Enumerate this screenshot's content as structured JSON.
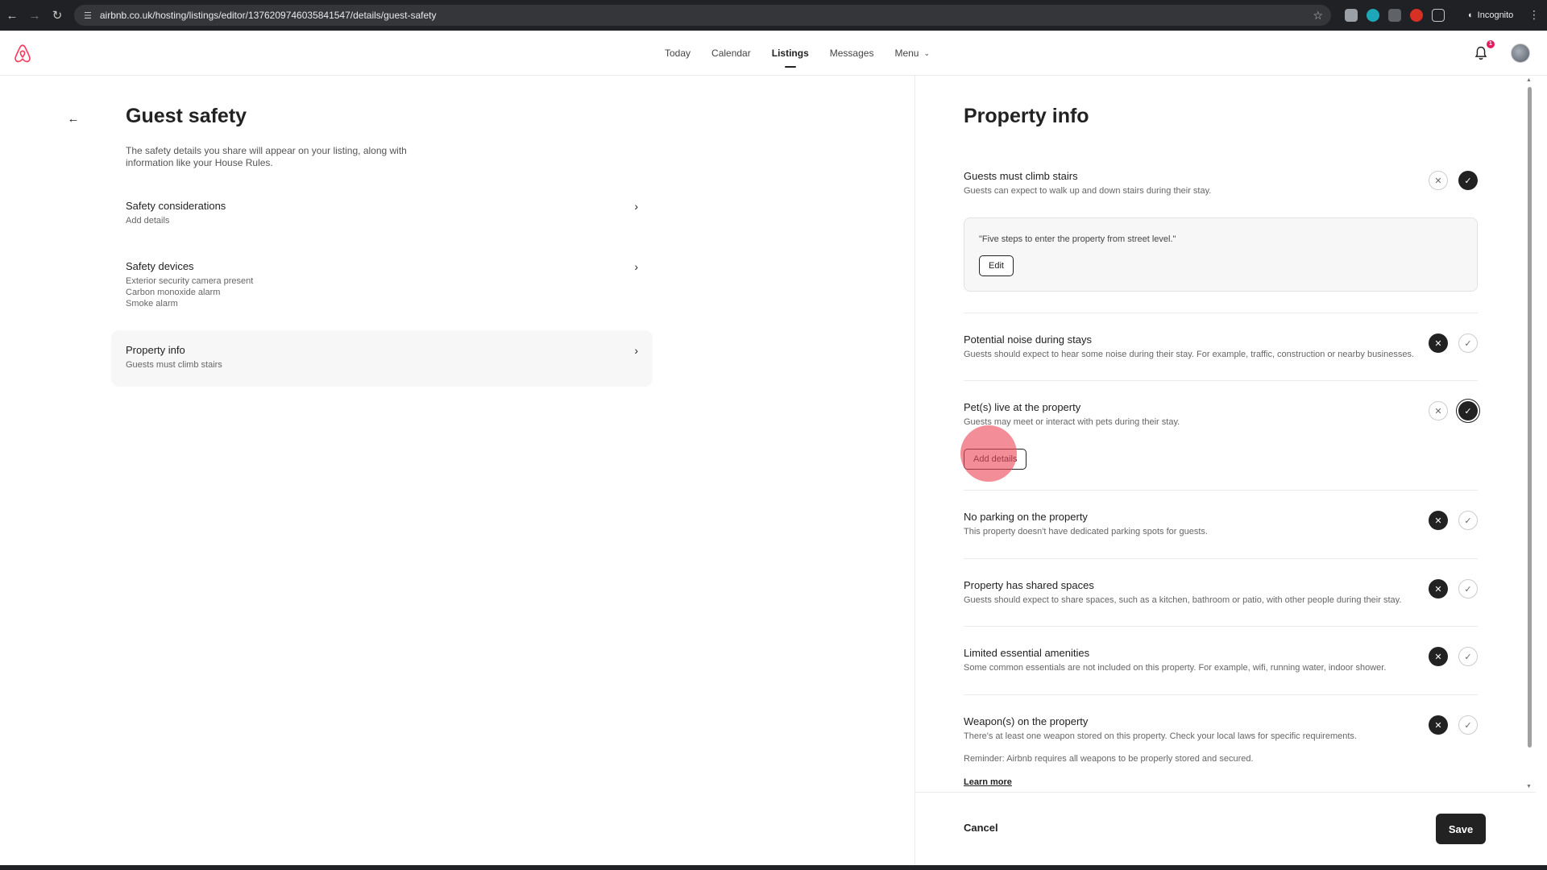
{
  "browser": {
    "url": "airbnb.co.uk/hosting/listings/editor/1376209746035841547/details/guest-safety",
    "incognito_label": "Incognito"
  },
  "topnav": {
    "items": [
      {
        "label": "Today"
      },
      {
        "label": "Calendar"
      },
      {
        "label": "Listings"
      },
      {
        "label": "Messages"
      },
      {
        "label": "Menu"
      }
    ],
    "active": "Listings",
    "notification_count": "1"
  },
  "left": {
    "title": "Guest safety",
    "description": "The safety details you share will appear on your listing, along with information like your House Rules.",
    "sections": [
      {
        "title": "Safety considerations",
        "subs": [
          "Add details"
        ]
      },
      {
        "title": "Safety devices",
        "subs": [
          "Exterior security camera present",
          "Carbon monoxide alarm",
          "Smoke alarm"
        ]
      },
      {
        "title": "Property info",
        "subs": [
          "Guests must climb stairs"
        ]
      }
    ]
  },
  "panel": {
    "title": "Property info",
    "rows": [
      {
        "title": "Guests must climb stairs",
        "desc": "Guests can expect to walk up and down stairs during their stay.",
        "value": "yes"
      },
      {
        "title": "Potential noise during stays",
        "desc": "Guests should expect to hear some noise during their stay. For example, traffic, construction or nearby businesses.",
        "value": "no"
      },
      {
        "title": "Pet(s) live at the property",
        "desc": "Guests may meet or interact with pets during their stay.",
        "value": "yes"
      },
      {
        "title": "No parking on the property",
        "desc": "This property doesn't have dedicated parking spots for guests.",
        "value": "no"
      },
      {
        "title": "Property has shared spaces",
        "desc": "Guests should expect to share spaces, such as a kitchen, bathroom or patio, with other people during their stay.",
        "value": "no"
      },
      {
        "title": "Limited essential amenities",
        "desc": "Some common essentials are not included on this property. For example, wifi, running water, indoor shower.",
        "value": "no"
      },
      {
        "title": "Weapon(s) on the property",
        "desc": "There's at least one weapon stored on this property. Check your local laws for specific requirements.",
        "value": "no"
      }
    ],
    "stairs_detail": "\"Five steps to enter the property from street level.\"",
    "edit_label": "Edit",
    "add_details_label": "Add details",
    "weapons_reminder": "Reminder: Airbnb requires all weapons to be properly stored and secured.",
    "learn_more": "Learn more"
  },
  "footer": {
    "cancel": "Cancel",
    "save": "Save"
  },
  "colors": {
    "brand": "#FF385C",
    "text": "#222222",
    "selected_bg": "#F7F7F7"
  }
}
